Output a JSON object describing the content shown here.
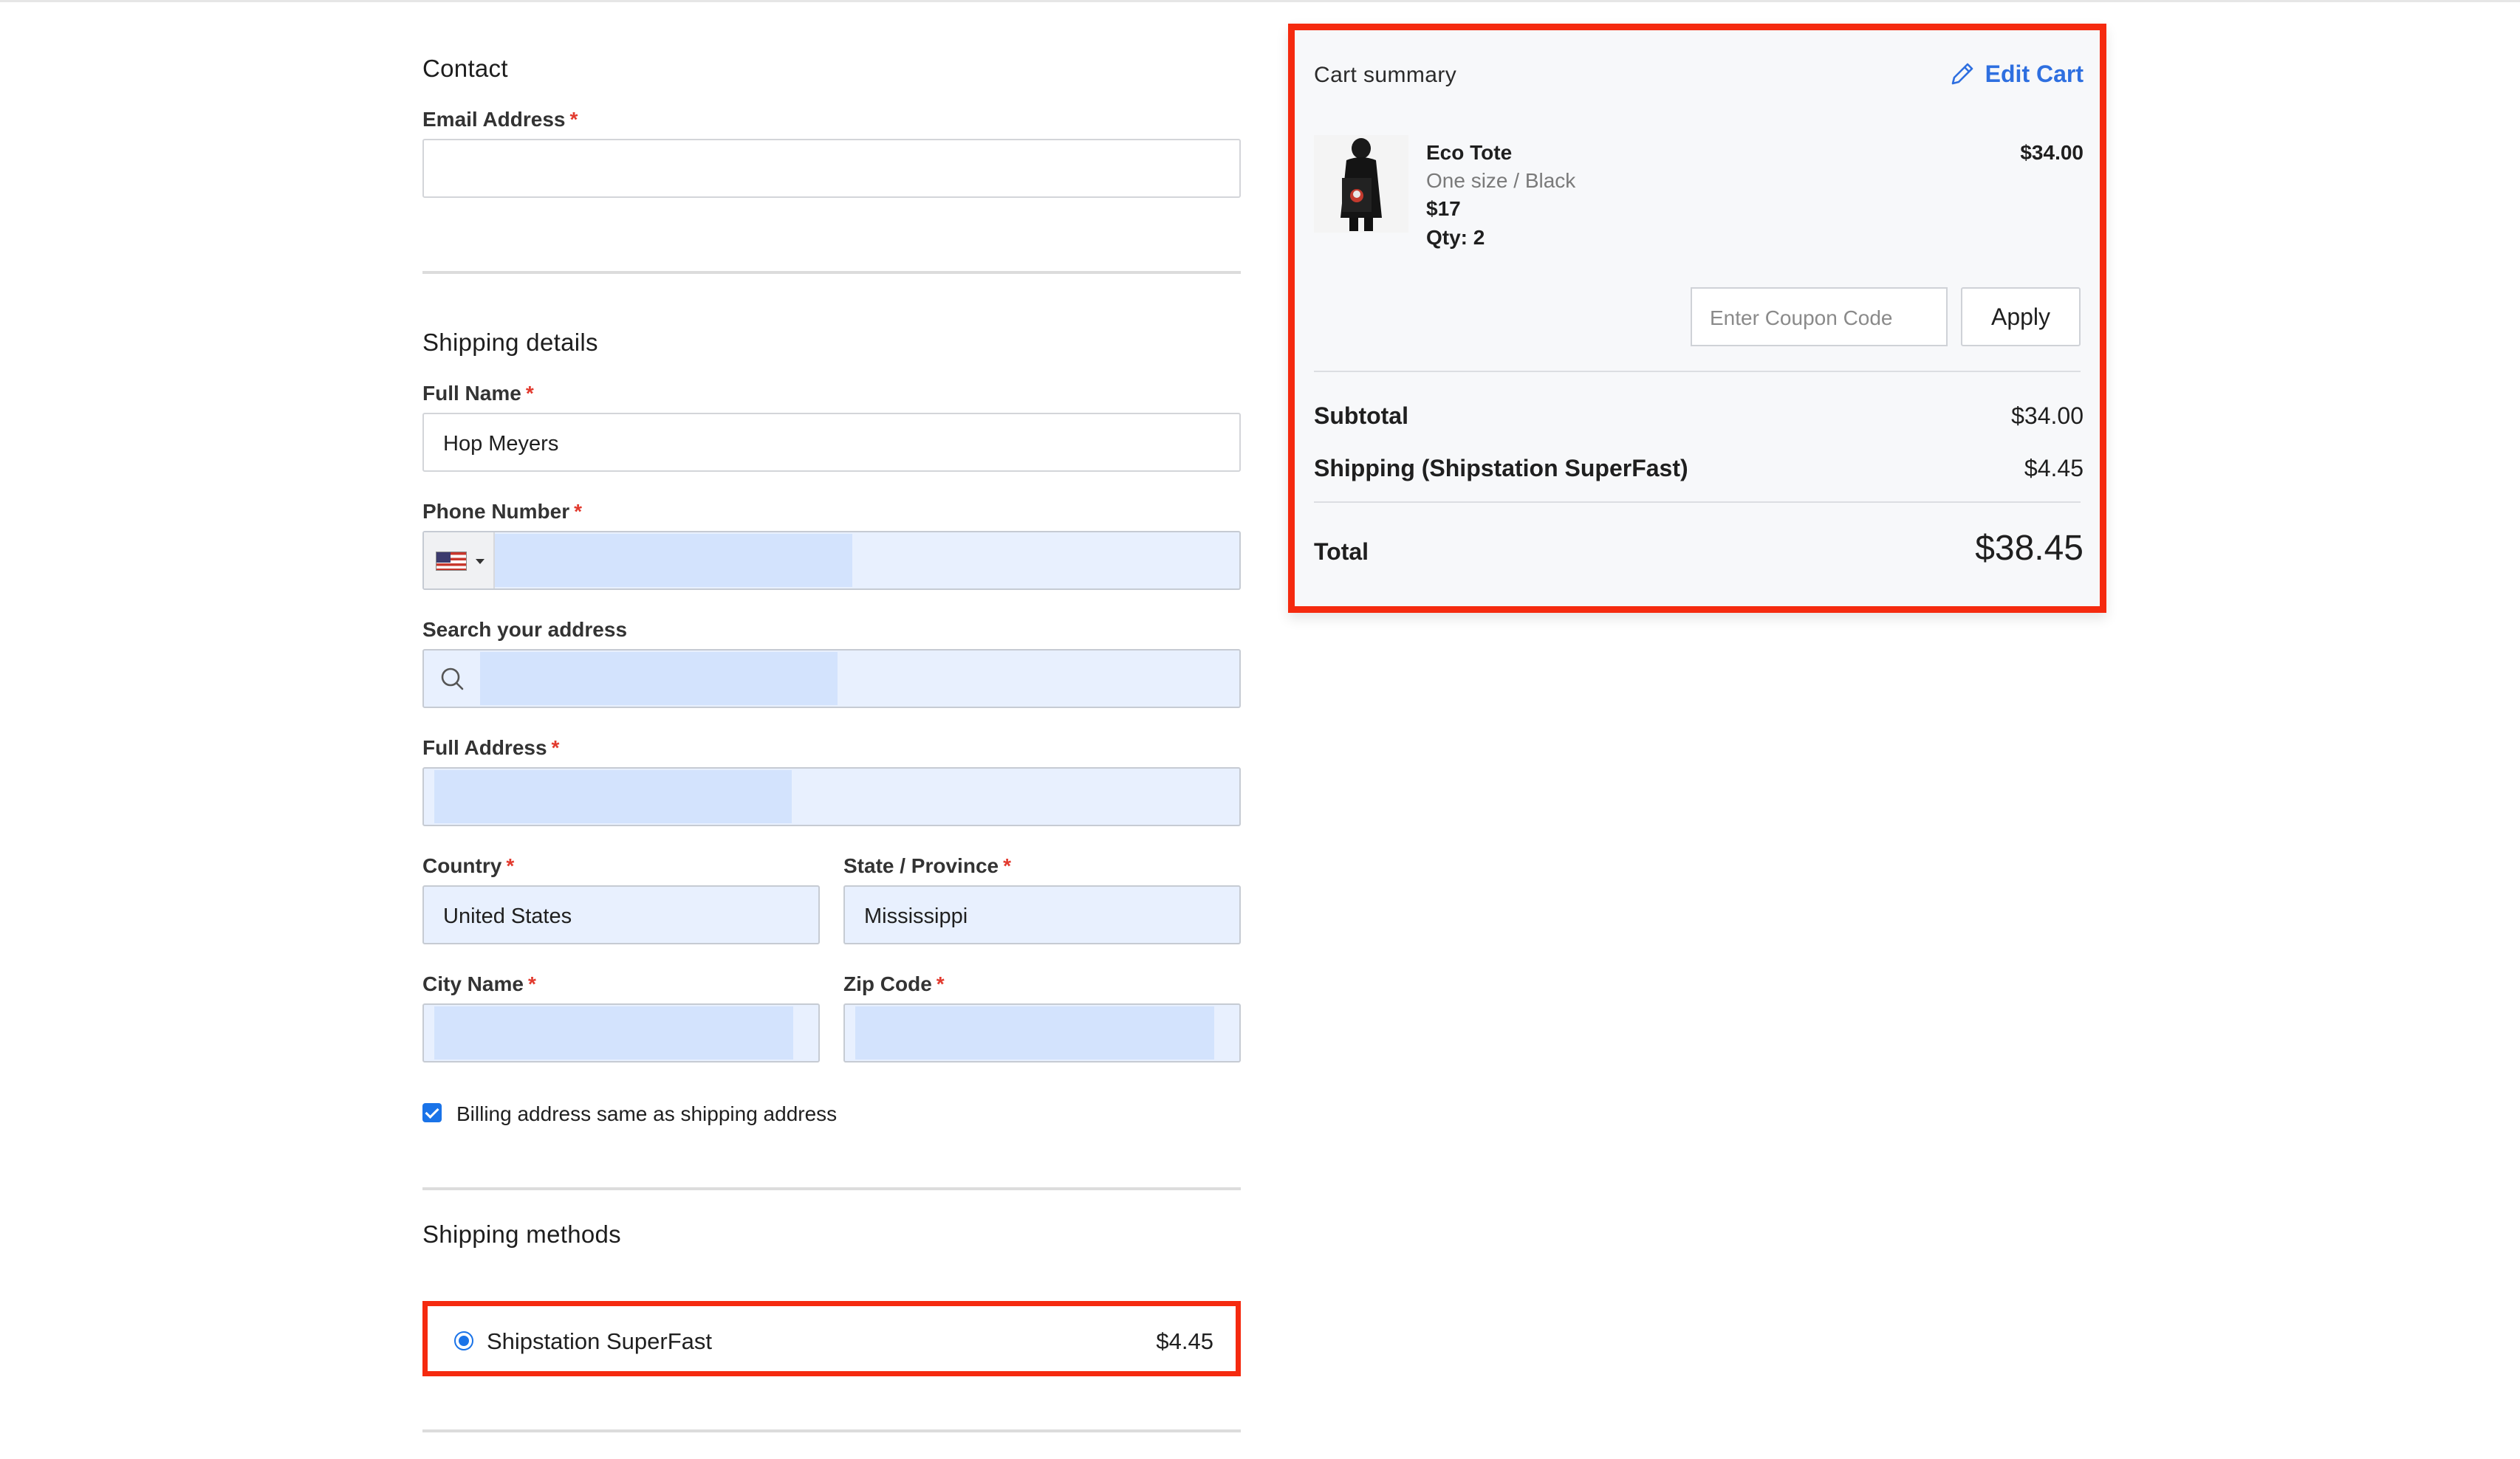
{
  "contact": {
    "section_title": "Contact",
    "email_label": "Email Address",
    "email_value": ""
  },
  "shipping_details": {
    "section_title": "Shipping details",
    "full_name_label": "Full Name",
    "full_name_value": "Hop Meyers",
    "phone_label": "Phone Number",
    "phone_value": "",
    "search_address_label": "Search your address",
    "search_address_value": "",
    "full_address_label": "Full Address",
    "full_address_value": "",
    "country_label": "Country",
    "country_value": "United States",
    "state_label": "State / Province",
    "state_value": "Mississippi",
    "city_label": "City Name",
    "city_value": "",
    "zip_label": "Zip Code",
    "zip_value": "",
    "required_mark": "*",
    "billing_same_label": "Billing address same as shipping address",
    "billing_same_checked": true
  },
  "shipping_methods": {
    "section_title": "Shipping methods",
    "options": [
      {
        "name": "Shipstation SuperFast",
        "price": "$4.45",
        "selected": true
      }
    ]
  },
  "cart": {
    "title": "Cart summary",
    "edit_label": "Edit Cart",
    "items": [
      {
        "name": "Eco Tote",
        "variant": "One size / Black",
        "unit_price": "$17",
        "qty": "Qty: 2",
        "line_total": "$34.00"
      }
    ],
    "coupon_placeholder": "Enter Coupon Code",
    "apply_label": "Apply",
    "subtotal_label": "Subtotal",
    "subtotal_value": "$34.00",
    "shipping_label": "Shipping (Shipstation SuperFast)",
    "shipping_value": "$4.45",
    "total_label": "Total",
    "total_value": "$38.45"
  },
  "colors": {
    "accent_blue": "#1a73e8",
    "link_blue": "#2e6fe0",
    "highlight_red": "#f52a0f",
    "autofill_bg": "#e8f0fe",
    "required_red": "#e23a2e"
  },
  "icons": {
    "phone_flag": "us-flag-icon",
    "search": "search-icon",
    "edit": "pencil-icon"
  }
}
